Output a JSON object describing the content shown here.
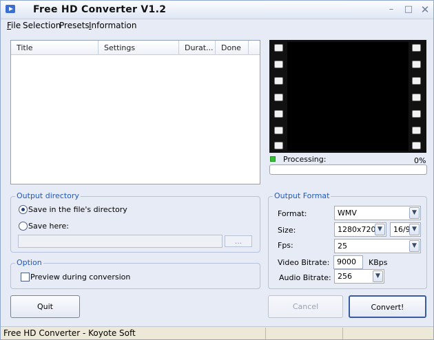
{
  "window": {
    "title": "Free HD Converter V1.2",
    "controls": {
      "minimize": "minimize-icon",
      "maximize": "maximize-icon",
      "close": "close-icon"
    }
  },
  "menu": {
    "items": [
      {
        "label": "File",
        "accel": "F",
        "rest": "ile"
      },
      {
        "label": "Selection"
      },
      {
        "label": "Presets"
      },
      {
        "label": "Information",
        "accel": "I",
        "rest": "nformation"
      }
    ]
  },
  "file_list": {
    "columns": [
      "Title",
      "Settings",
      "Durat...",
      "Done"
    ]
  },
  "processing": {
    "label": "Processing:",
    "percent": "0%",
    "progress": 0
  },
  "output_directory": {
    "title": "Output directory",
    "option_same_dir": "Save in the file's directory",
    "option_save_here": "Save here:",
    "path_value": "",
    "browse_label": "...",
    "selected": "same_dir"
  },
  "option": {
    "title": "Option",
    "preview_label": "Preview during conversion",
    "preview_checked": false
  },
  "output_format": {
    "title": "Output Format",
    "format_label": "Format:",
    "format_value": "WMV",
    "size_label": "Size:",
    "size_value": "1280x720",
    "aspect_value": "16/9",
    "fps_label": "Fps:",
    "fps_value": "25",
    "video_bitrate_label": "Video Bitrate:",
    "video_bitrate_value": "9000",
    "video_bitrate_unit": "KBps",
    "audio_bitrate_label": "Audio Bitrate:",
    "audio_bitrate_value": "256"
  },
  "buttons": {
    "quit": "Quit",
    "cancel": "Cancel",
    "convert": "Convert!"
  },
  "status_bar": {
    "text": "Free HD Converter - Koyote Soft"
  },
  "colors": {
    "window_bg": "#e6ebf6",
    "group_title": "#1f58c0",
    "processing_indicator": "#30c030"
  }
}
